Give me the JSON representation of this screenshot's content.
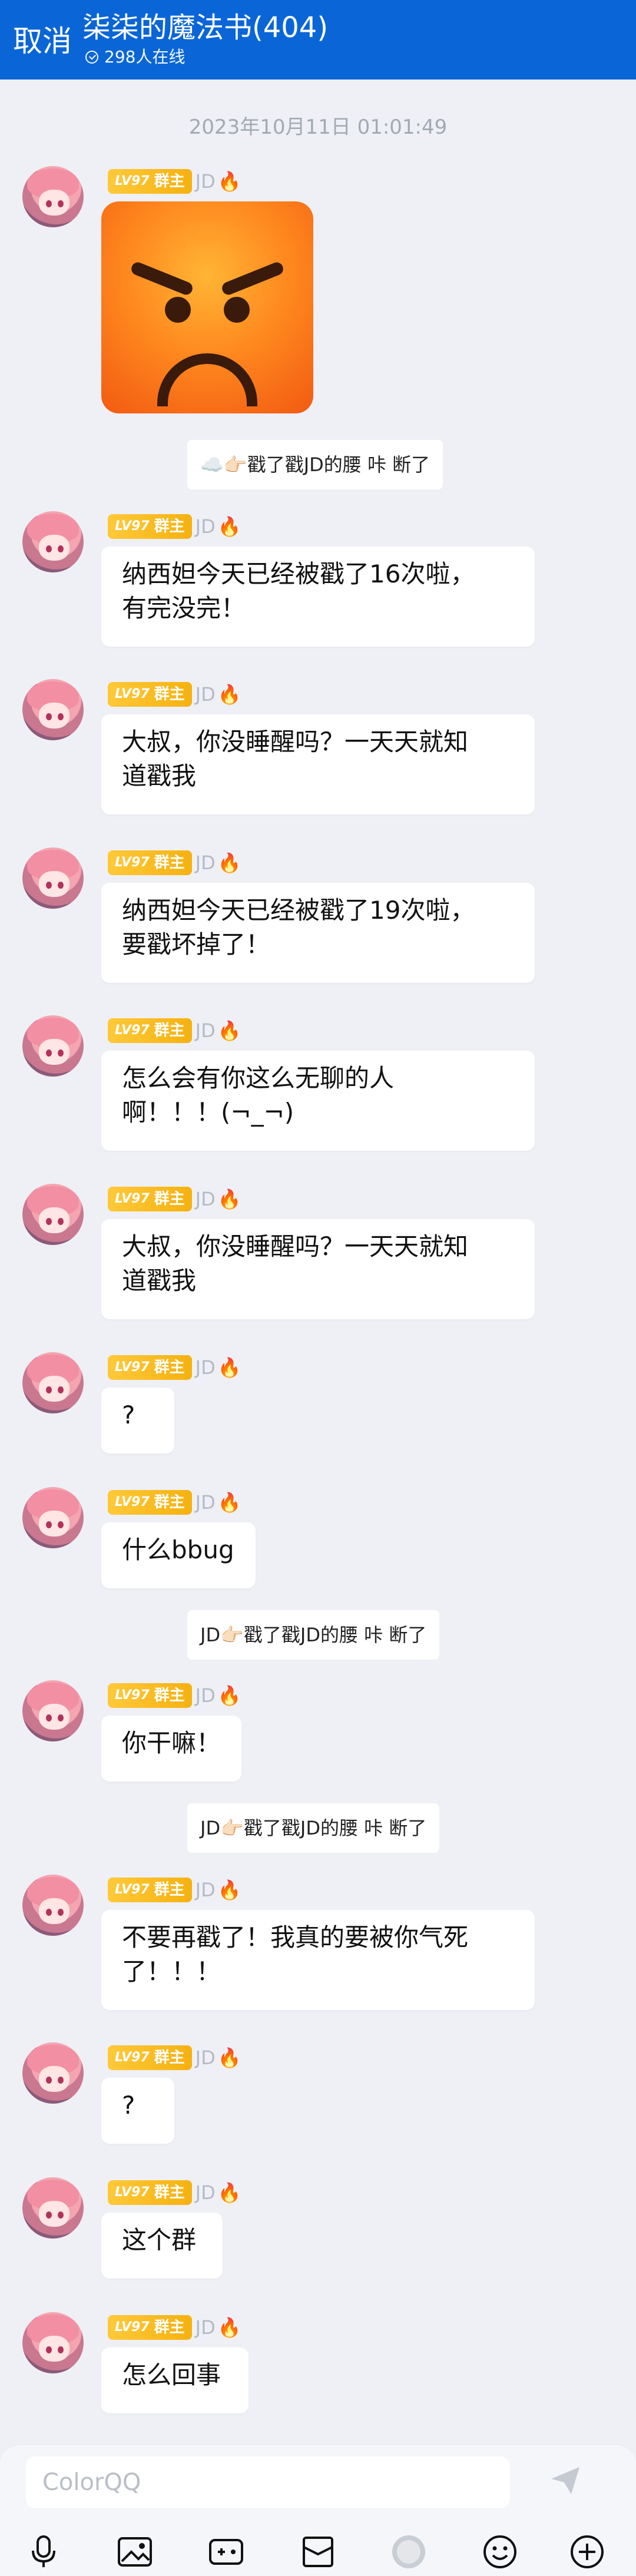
{
  "header": {
    "cancel_label": "取消",
    "title": "柒柒的魔法书(404)",
    "online_text": "298人在线"
  },
  "timestamp": "2023年10月11日  01:01:49",
  "sender": {
    "badge_level": "LV97",
    "badge_role": "群主",
    "name": "JD",
    "fire": "🔥"
  },
  "messages": [
    {
      "type": "sticker",
      "icon": "angry-face"
    },
    {
      "type": "system",
      "text": "☁️👉🏻戳了戳JD的腰 咔 断了"
    },
    {
      "type": "text",
      "lines": [
        "纳西妲今天已经被戳了16次啦，",
        "有完没完！"
      ]
    },
    {
      "type": "text",
      "lines": [
        "大叔，你没睡醒吗？一天天就知",
        "道戳我"
      ]
    },
    {
      "type": "text",
      "lines": [
        "纳西妲今天已经被戳了19次啦，",
        "要戳坏掉了！"
      ]
    },
    {
      "type": "text",
      "lines": [
        "怎么会有你这么无聊的人",
        "啊！！！(¬_¬)"
      ]
    },
    {
      "type": "text",
      "lines": [
        "大叔，你没睡醒吗？一天天就知",
        "道戳我"
      ]
    },
    {
      "type": "text",
      "lines": [
        "?"
      ]
    },
    {
      "type": "text",
      "lines": [
        "什么bbug"
      ]
    },
    {
      "type": "system",
      "text": "JD👉🏻戳了戳JD的腰 咔 断了"
    },
    {
      "type": "text",
      "lines": [
        "你干嘛！"
      ]
    },
    {
      "type": "system",
      "text": "JD👉🏻戳了戳JD的腰 咔 断了"
    },
    {
      "type": "text",
      "lines": [
        "不要再戳了！我真的要被你气死",
        "了！！！"
      ]
    },
    {
      "type": "text",
      "lines": [
        "?"
      ]
    },
    {
      "type": "text",
      "lines": [
        "这个群"
      ]
    },
    {
      "type": "text",
      "lines": [
        "怎么回事"
      ]
    }
  ],
  "input": {
    "placeholder": "ColorQQ"
  },
  "toolbar": [
    "mic-icon",
    "image-icon",
    "game-icon",
    "box-icon",
    "avatar-icon",
    "emoji-icon",
    "plus-icon"
  ]
}
